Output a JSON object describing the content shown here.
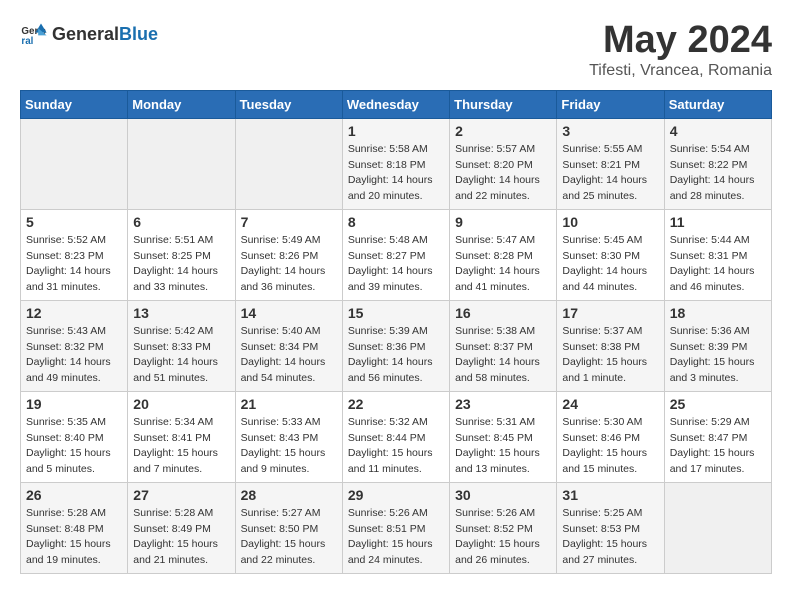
{
  "logo": {
    "general": "General",
    "blue": "Blue"
  },
  "title": "May 2024",
  "location": "Tifesti, Vrancea, Romania",
  "days_header": [
    "Sunday",
    "Monday",
    "Tuesday",
    "Wednesday",
    "Thursday",
    "Friday",
    "Saturday"
  ],
  "weeks": [
    [
      {
        "day": "",
        "info": ""
      },
      {
        "day": "",
        "info": ""
      },
      {
        "day": "",
        "info": ""
      },
      {
        "day": "1",
        "info": "Sunrise: 5:58 AM\nSunset: 8:18 PM\nDaylight: 14 hours\nand 20 minutes."
      },
      {
        "day": "2",
        "info": "Sunrise: 5:57 AM\nSunset: 8:20 PM\nDaylight: 14 hours\nand 22 minutes."
      },
      {
        "day": "3",
        "info": "Sunrise: 5:55 AM\nSunset: 8:21 PM\nDaylight: 14 hours\nand 25 minutes."
      },
      {
        "day": "4",
        "info": "Sunrise: 5:54 AM\nSunset: 8:22 PM\nDaylight: 14 hours\nand 28 minutes."
      }
    ],
    [
      {
        "day": "5",
        "info": "Sunrise: 5:52 AM\nSunset: 8:23 PM\nDaylight: 14 hours\nand 31 minutes."
      },
      {
        "day": "6",
        "info": "Sunrise: 5:51 AM\nSunset: 8:25 PM\nDaylight: 14 hours\nand 33 minutes."
      },
      {
        "day": "7",
        "info": "Sunrise: 5:49 AM\nSunset: 8:26 PM\nDaylight: 14 hours\nand 36 minutes."
      },
      {
        "day": "8",
        "info": "Sunrise: 5:48 AM\nSunset: 8:27 PM\nDaylight: 14 hours\nand 39 minutes."
      },
      {
        "day": "9",
        "info": "Sunrise: 5:47 AM\nSunset: 8:28 PM\nDaylight: 14 hours\nand 41 minutes."
      },
      {
        "day": "10",
        "info": "Sunrise: 5:45 AM\nSunset: 8:30 PM\nDaylight: 14 hours\nand 44 minutes."
      },
      {
        "day": "11",
        "info": "Sunrise: 5:44 AM\nSunset: 8:31 PM\nDaylight: 14 hours\nand 46 minutes."
      }
    ],
    [
      {
        "day": "12",
        "info": "Sunrise: 5:43 AM\nSunset: 8:32 PM\nDaylight: 14 hours\nand 49 minutes."
      },
      {
        "day": "13",
        "info": "Sunrise: 5:42 AM\nSunset: 8:33 PM\nDaylight: 14 hours\nand 51 minutes."
      },
      {
        "day": "14",
        "info": "Sunrise: 5:40 AM\nSunset: 8:34 PM\nDaylight: 14 hours\nand 54 minutes."
      },
      {
        "day": "15",
        "info": "Sunrise: 5:39 AM\nSunset: 8:36 PM\nDaylight: 14 hours\nand 56 minutes."
      },
      {
        "day": "16",
        "info": "Sunrise: 5:38 AM\nSunset: 8:37 PM\nDaylight: 14 hours\nand 58 minutes."
      },
      {
        "day": "17",
        "info": "Sunrise: 5:37 AM\nSunset: 8:38 PM\nDaylight: 15 hours\nand 1 minute."
      },
      {
        "day": "18",
        "info": "Sunrise: 5:36 AM\nSunset: 8:39 PM\nDaylight: 15 hours\nand 3 minutes."
      }
    ],
    [
      {
        "day": "19",
        "info": "Sunrise: 5:35 AM\nSunset: 8:40 PM\nDaylight: 15 hours\nand 5 minutes."
      },
      {
        "day": "20",
        "info": "Sunrise: 5:34 AM\nSunset: 8:41 PM\nDaylight: 15 hours\nand 7 minutes."
      },
      {
        "day": "21",
        "info": "Sunrise: 5:33 AM\nSunset: 8:43 PM\nDaylight: 15 hours\nand 9 minutes."
      },
      {
        "day": "22",
        "info": "Sunrise: 5:32 AM\nSunset: 8:44 PM\nDaylight: 15 hours\nand 11 minutes."
      },
      {
        "day": "23",
        "info": "Sunrise: 5:31 AM\nSunset: 8:45 PM\nDaylight: 15 hours\nand 13 minutes."
      },
      {
        "day": "24",
        "info": "Sunrise: 5:30 AM\nSunset: 8:46 PM\nDaylight: 15 hours\nand 15 minutes."
      },
      {
        "day": "25",
        "info": "Sunrise: 5:29 AM\nSunset: 8:47 PM\nDaylight: 15 hours\nand 17 minutes."
      }
    ],
    [
      {
        "day": "26",
        "info": "Sunrise: 5:28 AM\nSunset: 8:48 PM\nDaylight: 15 hours\nand 19 minutes."
      },
      {
        "day": "27",
        "info": "Sunrise: 5:28 AM\nSunset: 8:49 PM\nDaylight: 15 hours\nand 21 minutes."
      },
      {
        "day": "28",
        "info": "Sunrise: 5:27 AM\nSunset: 8:50 PM\nDaylight: 15 hours\nand 22 minutes."
      },
      {
        "day": "29",
        "info": "Sunrise: 5:26 AM\nSunset: 8:51 PM\nDaylight: 15 hours\nand 24 minutes."
      },
      {
        "day": "30",
        "info": "Sunrise: 5:26 AM\nSunset: 8:52 PM\nDaylight: 15 hours\nand 26 minutes."
      },
      {
        "day": "31",
        "info": "Sunrise: 5:25 AM\nSunset: 8:53 PM\nDaylight: 15 hours\nand 27 minutes."
      },
      {
        "day": "",
        "info": ""
      }
    ]
  ]
}
